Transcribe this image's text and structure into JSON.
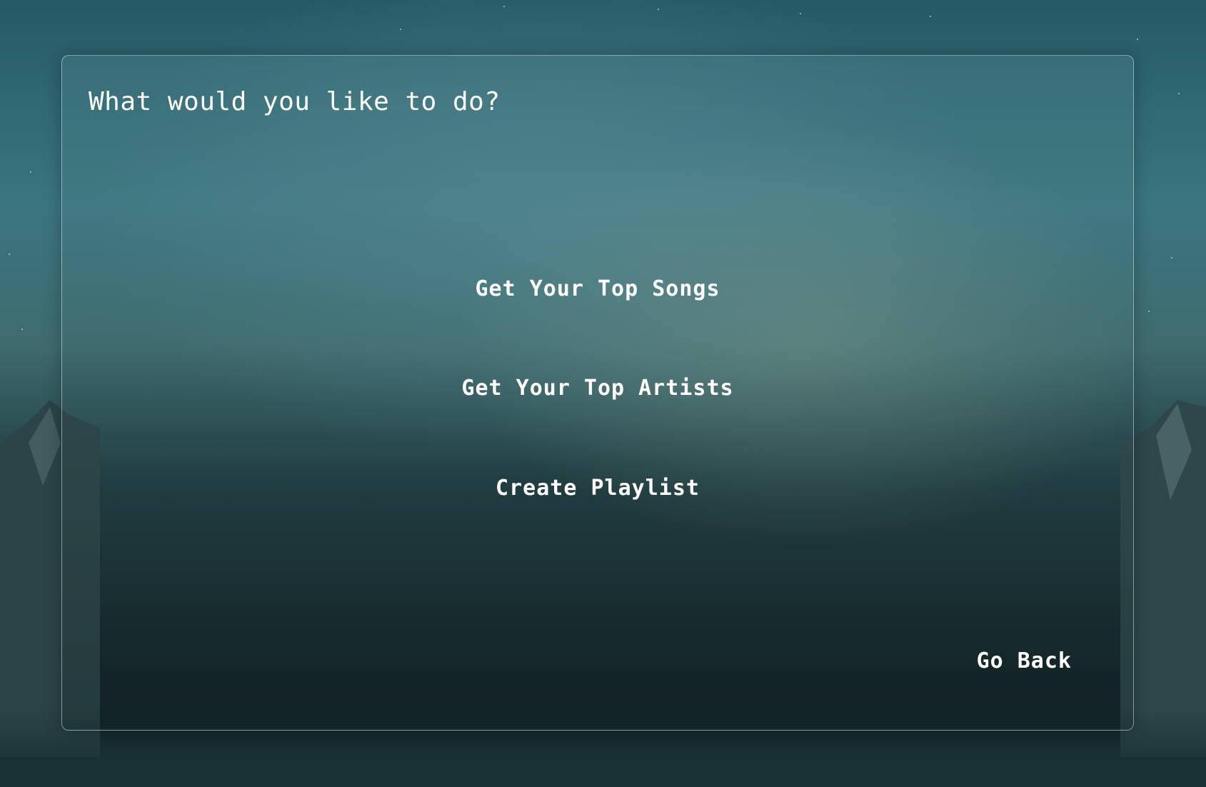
{
  "page": {
    "title": "What would you like to do?"
  },
  "menu": {
    "items": [
      {
        "label": "Get Your Top Songs"
      },
      {
        "label": "Get Your Top Artists"
      },
      {
        "label": "Create Playlist"
      }
    ]
  },
  "navigation": {
    "back_label": "Go Back"
  },
  "theme": {
    "text_color": "#ffffff",
    "background": "night mountain sky, teal",
    "panel_border": "#d2e6e6"
  }
}
